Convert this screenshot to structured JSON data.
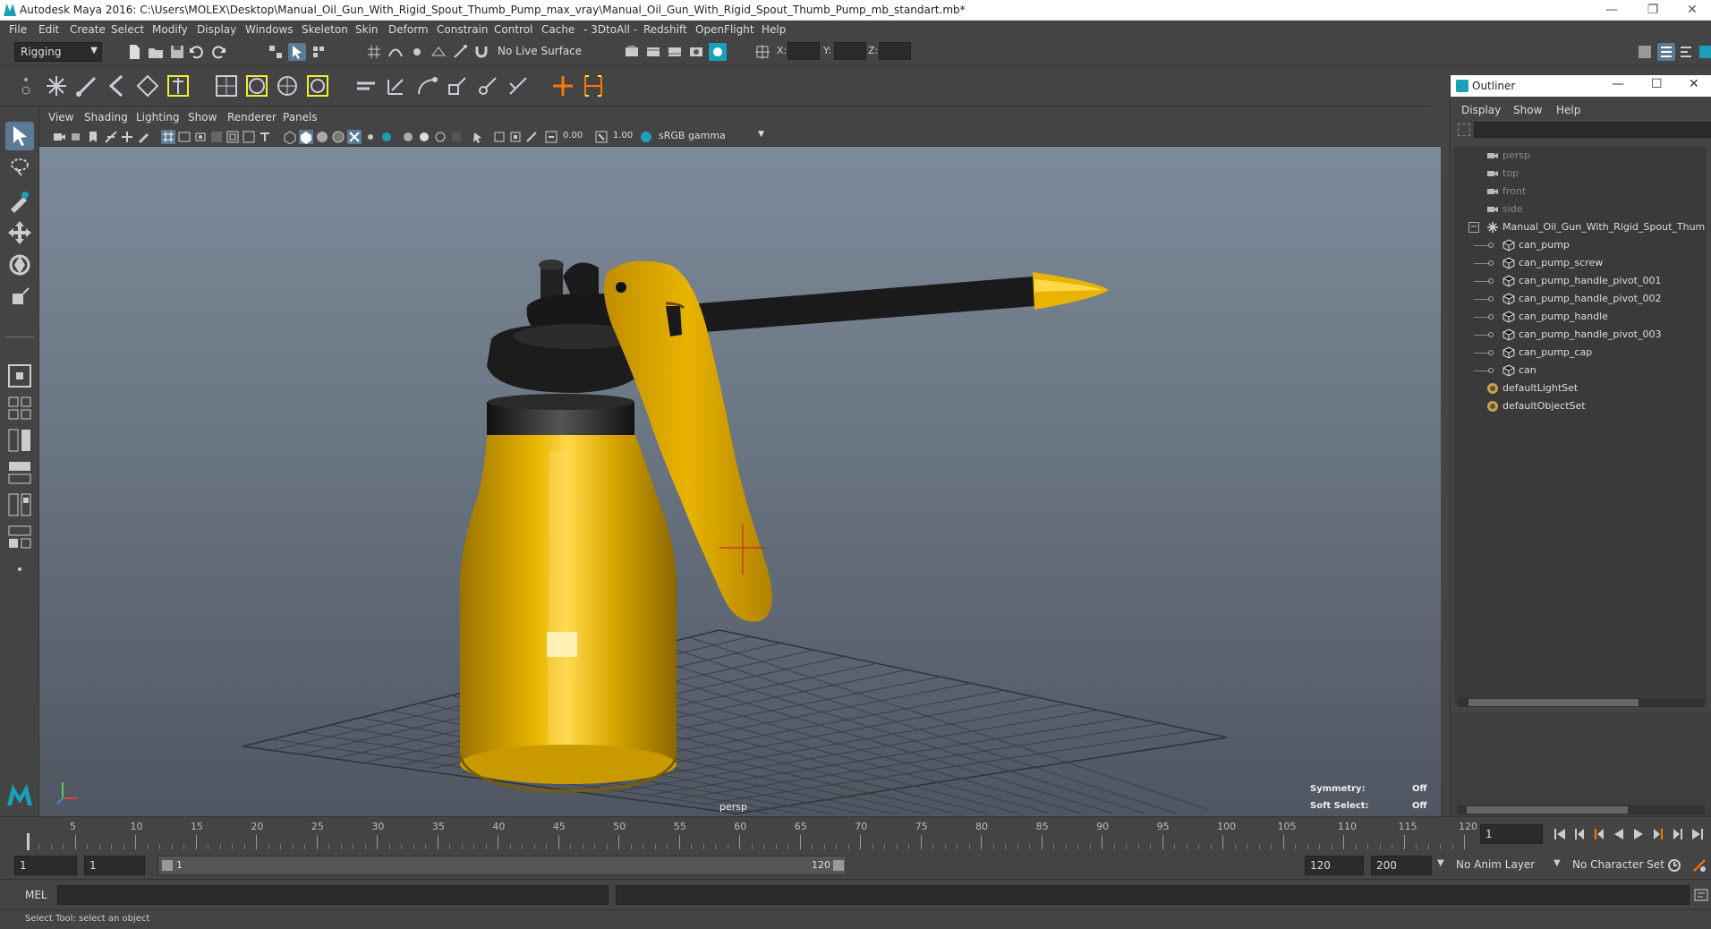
{
  "app": {
    "title": "Autodesk Maya 2016: C:\\Users\\MOLEX\\Desktop\\Manual_Oil_Gun_With_Rigid_Spout_Thumb_Pump_max_vray\\Manual_Oil_Gun_With_Rigid_Spout_Thumb_Pump_mb_standart.mb*",
    "window_buttons": {
      "minimize": "—",
      "restore": "❐",
      "close": "✕"
    }
  },
  "menubar": [
    "File",
    "Edit",
    "Create",
    "Select",
    "Modify",
    "Display",
    "Windows",
    "Skeleton",
    "Skin",
    "Deform",
    "Constrain",
    "Control",
    "Cache",
    "- 3DtoAll -",
    "Redshift",
    "OpenFlight",
    "Help"
  ],
  "statusline": {
    "menu_set": "Rigging",
    "live_surface": "No Live Surface",
    "x_label": "X:",
    "y_label": "Y:",
    "z_label": "Z:"
  },
  "viewport": {
    "menu": [
      "View",
      "Shading",
      "Lighting",
      "Show",
      "Renderer",
      "Panels"
    ],
    "exposure": "0.00",
    "gamma": "1.00",
    "color_space": "sRGB gamma",
    "camera_label": "persp",
    "hud": {
      "symmetry_label": "Symmetry:",
      "symmetry_value": "Off",
      "soft_select_label": "Soft Select:",
      "soft_select_value": "Off"
    }
  },
  "outliner": {
    "title": "Outliner",
    "menu": [
      "Display",
      "Show",
      "Help"
    ],
    "items": [
      {
        "label": "persp",
        "type": "camera",
        "depth": 0,
        "dim": true
      },
      {
        "label": "top",
        "type": "camera",
        "depth": 0,
        "dim": true
      },
      {
        "label": "front",
        "type": "camera",
        "depth": 0,
        "dim": true
      },
      {
        "label": "side",
        "type": "camera",
        "depth": 0,
        "dim": true
      },
      {
        "label": "Manual_Oil_Gun_With_Rigid_Spout_Thum",
        "type": "group",
        "depth": 0,
        "dim": false
      },
      {
        "label": "can_pump",
        "type": "mesh",
        "depth": 1,
        "dim": false
      },
      {
        "label": "can_pump_screw",
        "type": "mesh",
        "depth": 1,
        "dim": false
      },
      {
        "label": "can_pump_handle_pivot_001",
        "type": "mesh",
        "depth": 1,
        "dim": false
      },
      {
        "label": "can_pump_handle_pivot_002",
        "type": "mesh",
        "depth": 1,
        "dim": false
      },
      {
        "label": "can_pump_handle",
        "type": "mesh",
        "depth": 1,
        "dim": false
      },
      {
        "label": "can_pump_handle_pivot_003",
        "type": "mesh",
        "depth": 1,
        "dim": false
      },
      {
        "label": "can_pump_cap",
        "type": "mesh",
        "depth": 1,
        "dim": false
      },
      {
        "label": "can",
        "type": "mesh",
        "depth": 1,
        "dim": false
      },
      {
        "label": "defaultLightSet",
        "type": "set",
        "depth": 0,
        "dim": false
      },
      {
        "label": "defaultObjectSet",
        "type": "set",
        "depth": 0,
        "dim": false
      }
    ]
  },
  "timeslider": {
    "ticks": [
      1,
      5,
      10,
      15,
      20,
      25,
      30,
      35,
      40,
      45,
      50,
      55,
      60,
      65,
      70,
      75,
      80,
      85,
      90,
      95,
      100,
      105,
      110,
      115,
      120
    ],
    "current_frame": "1"
  },
  "rangeslider": {
    "start": "1",
    "playback_start": "1",
    "range_start_label": "1",
    "range_end_label": "120",
    "playback_end": "120",
    "end": "200",
    "anim_layer": "No Anim Layer",
    "character_set": "No Character Set"
  },
  "cmdline": {
    "mode": "MEL"
  },
  "helpline": {
    "text": "Select Tool: select an object"
  },
  "colors": {
    "accent": "#1aa0b8",
    "object_yellow": "#e8b400",
    "dark_part": "#1a1a1a"
  }
}
